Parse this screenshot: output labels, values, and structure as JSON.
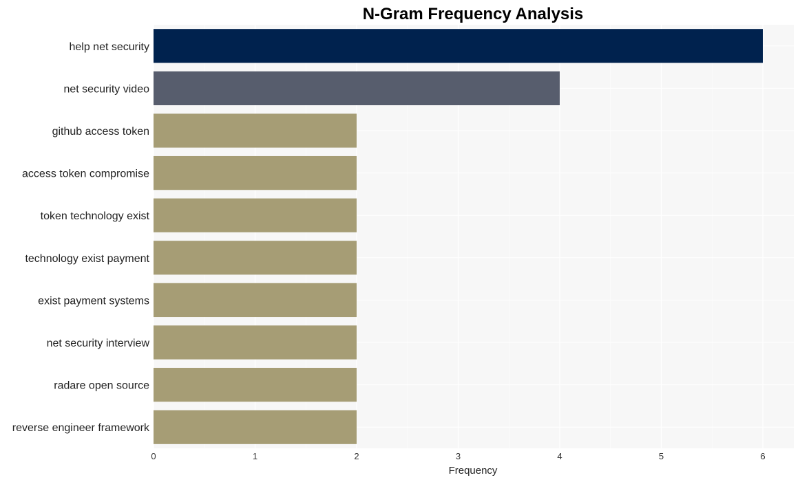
{
  "chart_data": {
    "type": "bar",
    "orientation": "horizontal",
    "title": "N-Gram Frequency Analysis",
    "xlabel": "Frequency",
    "ylabel": "",
    "xlim": [
      0,
      6.3
    ],
    "xticks": [
      0,
      1,
      2,
      3,
      4,
      5,
      6
    ],
    "grid": true,
    "categories": [
      "help net security",
      "net security video",
      "github access token",
      "access token compromise",
      "token technology exist",
      "technology exist payment",
      "exist payment systems",
      "net security interview",
      "radare open source",
      "reverse engineer framework"
    ],
    "values": [
      6,
      4,
      2,
      2,
      2,
      2,
      2,
      2,
      2,
      2
    ],
    "colors": [
      "#00224e",
      "#575d6d",
      "#a69d75",
      "#a69d75",
      "#a69d75",
      "#a69d75",
      "#a69d75",
      "#a69d75",
      "#a69d75",
      "#a69d75"
    ],
    "plot_background": "#f7f7f7"
  }
}
